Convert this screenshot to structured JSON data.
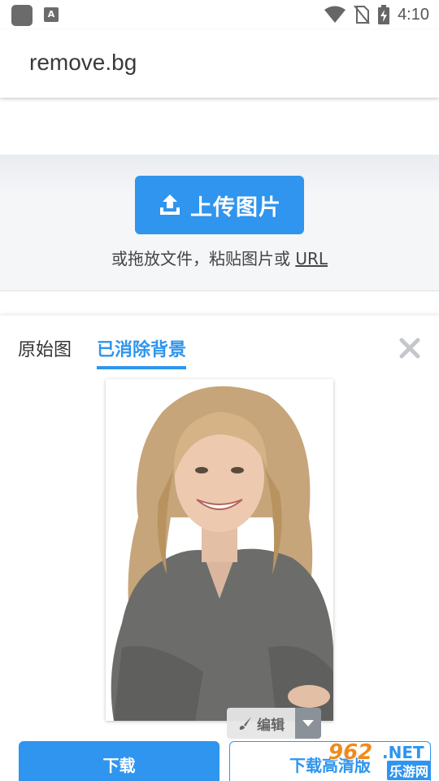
{
  "status_bar": {
    "time": "4:10",
    "icons": [
      "app-icon",
      "accessibility-icon",
      "wifi-icon",
      "no-sim-icon",
      "battery-charging-icon"
    ]
  },
  "app_bar": {
    "title": "remove.bg"
  },
  "upload": {
    "button_label": "上传图片",
    "hint_prefix": "或拖放文件，粘贴图片或",
    "hint_url": "URL"
  },
  "result": {
    "tabs": [
      {
        "label": "原始图",
        "active": false
      },
      {
        "label": "已消除背景",
        "active": true
      }
    ],
    "edit_label": "编辑",
    "download_label": "下载",
    "download_hd_label": "下载高清版"
  },
  "watermark": {
    "brand": "962",
    "net": ".NET",
    "site": "乐游网"
  },
  "colors": {
    "accent": "#2f95ee",
    "upload_bg": "#f5f6f8",
    "text": "#333333"
  }
}
